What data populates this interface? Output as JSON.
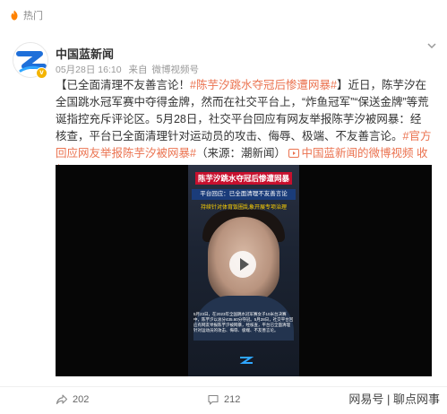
{
  "header": {
    "hot_label": "热门",
    "hot_icon": "flame-icon"
  },
  "post": {
    "author": "中国蓝新闻",
    "avatar_badge": "v",
    "meta": {
      "date": "05月28日 16:10",
      "source": "来自",
      "client": "微博视频号"
    },
    "text": {
      "bracket_open": "【",
      "headline": "已全面清理不友善言论！",
      "topic1": "#陈芋汐跳水夺冠后惨遭网暴#",
      "bracket_close": "】",
      "body": "近日，陈芋汐在全国跳水冠军赛中夺得金牌，然而在社交平台上，“炸鱼冠军”“保送金牌”等荒诞指控充斥评论区。5月28日，社交平台回应有网友举报陈芋汐被网暴：经核查，平台已全面清理针对运动员的攻击、侮辱、极端、不友善言论。",
      "topic2": "#官方回应网友举报陈芋汐被网暴#",
      "source_note": "（来源：潮新闻）",
      "video_link": "中国蓝新闻的微博视频",
      "collapse": "收起",
      "collapse_arrow": "^"
    },
    "video": {
      "headline": "陈芋汐跳水夺冠后惨遭网暴",
      "title": "平台回应：已全面清理不友善言论",
      "ticker": "持续针对体育饭圈乱象开展专项治理",
      "subtitle": "5月23日，在2023年全国跳水冠军赛女子10米台决赛中，陈芋汐以总分435.60分夺冠。5月28日，社交平台回应有网友举报陈芋汐被网暴，经核查，平台已全面清理针对运动员的攻击、侮辱、极端、不友善言论。"
    },
    "actions": {
      "share_count": "202",
      "comment_count": "212"
    }
  },
  "watermark": "网易号 | 聊点网事",
  "colors": {
    "topic": "#eb7350",
    "headline_bg": "#c8102e",
    "title_bg": "#1a3c7a",
    "ticker": "#ffd200"
  }
}
